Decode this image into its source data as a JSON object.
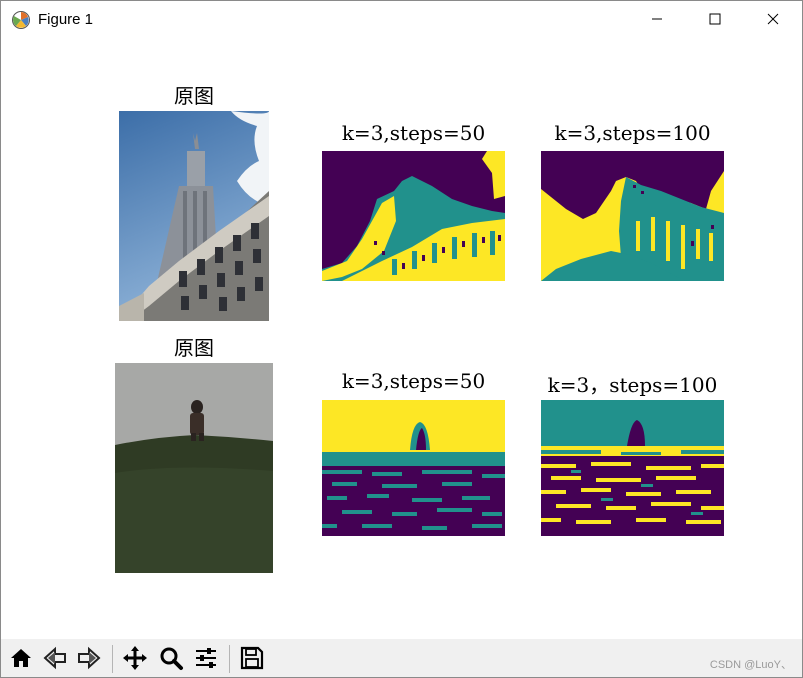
{
  "window": {
    "title": "Figure 1",
    "app_icon": "matplotlib-icon",
    "controls": [
      "minimize-icon",
      "maximize-icon",
      "close-icon"
    ]
  },
  "figure": {
    "row1": {
      "original_title": "原图",
      "k3_50_title": "k=3,steps=50",
      "k3_100_title": "k=3,steps=100"
    },
    "row2": {
      "original_title": "原图",
      "k3_50_title": "k=3,steps=50",
      "k3_100_title": "k=3，steps=100"
    },
    "palette": {
      "purple": "#440154",
      "teal": "#21918c",
      "yellow": "#fde725"
    }
  },
  "toolbar": {
    "tools": [
      "home-icon",
      "back-icon",
      "forward-icon",
      "pan-icon",
      "zoom-icon",
      "configure-subplots-icon",
      "save-icon"
    ]
  },
  "watermark": "CSDN @LuoY、"
}
